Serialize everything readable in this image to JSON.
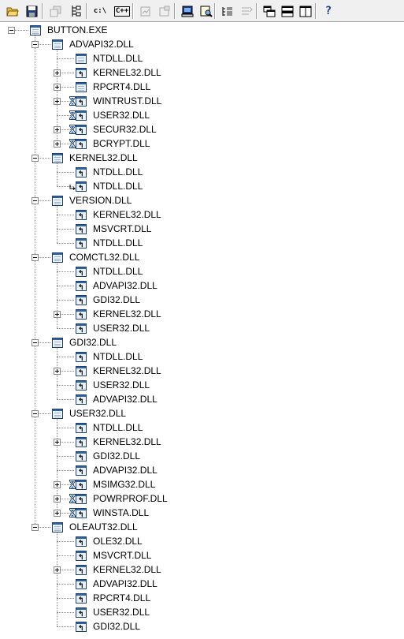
{
  "toolbar": {
    "buttons": [
      {
        "name": "open-icon",
        "glyph": "",
        "enabled": true
      },
      {
        "name": "save-icon",
        "glyph": "",
        "enabled": true
      },
      {
        "name": "copy-icon",
        "glyph": "",
        "enabled": false
      },
      {
        "name": "configure-search-paths-icon",
        "glyph": "",
        "enabled": true
      },
      {
        "name": "full-paths-icon",
        "glyph": "c:\\",
        "enabled": true
      },
      {
        "name": "undecorate-cpp-icon",
        "glyph": "C++",
        "enabled": true
      },
      {
        "name": "ordinal-icon",
        "glyph": "",
        "enabled": false
      },
      {
        "name": "properties-icon",
        "glyph": "",
        "enabled": false
      },
      {
        "name": "system-info-icon",
        "glyph": "",
        "enabled": true
      },
      {
        "name": "find-icon",
        "glyph": "",
        "enabled": true
      },
      {
        "name": "expand-all-icon",
        "glyph": "",
        "enabled": true
      },
      {
        "name": "collapse-icon",
        "glyph": "",
        "enabled": false
      },
      {
        "name": "cascade-windows-icon",
        "glyph": "",
        "enabled": true
      },
      {
        "name": "tile-horizontally-icon",
        "glyph": "",
        "enabled": true
      },
      {
        "name": "tile-vertically-icon",
        "glyph": "",
        "enabled": true
      },
      {
        "name": "help-icon",
        "glyph": "?",
        "enabled": true
      }
    ]
  },
  "tree": [
    {
      "label": "BUTTON.EXE",
      "depth": 0,
      "expander": "minus",
      "icon": "exe",
      "badge": "none"
    },
    {
      "label": "ADVAPI32.DLL",
      "depth": 1,
      "expander": "minus",
      "icon": "module",
      "badge": "none"
    },
    {
      "label": "NTDLL.DLL",
      "depth": 2,
      "expander": "none",
      "icon": "module",
      "badge": "none"
    },
    {
      "label": "KERNEL32.DLL",
      "depth": 2,
      "expander": "plus",
      "icon": "module-dup",
      "badge": "none"
    },
    {
      "label": "RPCRT4.DLL",
      "depth": 2,
      "expander": "plus",
      "icon": "module",
      "badge": "none"
    },
    {
      "label": "WINTRUST.DLL",
      "depth": 2,
      "expander": "plus",
      "icon": "module-dup",
      "badge": "delay"
    },
    {
      "label": "USER32.DLL",
      "depth": 2,
      "expander": "none",
      "icon": "module-dup",
      "badge": "delay"
    },
    {
      "label": "SECUR32.DLL",
      "depth": 2,
      "expander": "plus",
      "icon": "module-dup",
      "badge": "delay"
    },
    {
      "label": "BCRYPT.DLL",
      "depth": 2,
      "expander": "plus",
      "icon": "module-dup",
      "badge": "delay"
    },
    {
      "label": "KERNEL32.DLL",
      "depth": 1,
      "expander": "minus",
      "icon": "module",
      "badge": "none"
    },
    {
      "label": "NTDLL.DLL",
      "depth": 2,
      "expander": "none",
      "icon": "module-dup",
      "badge": "none"
    },
    {
      "label": "NTDLL.DLL",
      "depth": 2,
      "expander": "none",
      "icon": "module-dup",
      "badge": "forward"
    },
    {
      "label": "VERSION.DLL",
      "depth": 1,
      "expander": "minus",
      "icon": "module",
      "badge": "none"
    },
    {
      "label": "KERNEL32.DLL",
      "depth": 2,
      "expander": "none",
      "icon": "module-dup",
      "badge": "none"
    },
    {
      "label": "MSVCRT.DLL",
      "depth": 2,
      "expander": "none",
      "icon": "module-dup",
      "badge": "none"
    },
    {
      "label": "NTDLL.DLL",
      "depth": 2,
      "expander": "none",
      "icon": "module-dup",
      "badge": "none"
    },
    {
      "label": "COMCTL32.DLL",
      "depth": 1,
      "expander": "minus",
      "icon": "module",
      "badge": "none"
    },
    {
      "label": "NTDLL.DLL",
      "depth": 2,
      "expander": "none",
      "icon": "module-dup",
      "badge": "none"
    },
    {
      "label": "ADVAPI32.DLL",
      "depth": 2,
      "expander": "none",
      "icon": "module-dup",
      "badge": "none"
    },
    {
      "label": "GDI32.DLL",
      "depth": 2,
      "expander": "none",
      "icon": "module-dup",
      "badge": "none"
    },
    {
      "label": "KERNEL32.DLL",
      "depth": 2,
      "expander": "plus",
      "icon": "module-dup",
      "badge": "none"
    },
    {
      "label": "USER32.DLL",
      "depth": 2,
      "expander": "none",
      "icon": "module-dup",
      "badge": "none"
    },
    {
      "label": "GDI32.DLL",
      "depth": 1,
      "expander": "minus",
      "icon": "module",
      "badge": "none"
    },
    {
      "label": "NTDLL.DLL",
      "depth": 2,
      "expander": "none",
      "icon": "module-dup",
      "badge": "none"
    },
    {
      "label": "KERNEL32.DLL",
      "depth": 2,
      "expander": "plus",
      "icon": "module-dup",
      "badge": "none"
    },
    {
      "label": "USER32.DLL",
      "depth": 2,
      "expander": "none",
      "icon": "module-dup",
      "badge": "none"
    },
    {
      "label": "ADVAPI32.DLL",
      "depth": 2,
      "expander": "none",
      "icon": "module-dup",
      "badge": "none"
    },
    {
      "label": "USER32.DLL",
      "depth": 1,
      "expander": "minus",
      "icon": "module",
      "badge": "none"
    },
    {
      "label": "NTDLL.DLL",
      "depth": 2,
      "expander": "none",
      "icon": "module-dup",
      "badge": "none"
    },
    {
      "label": "KERNEL32.DLL",
      "depth": 2,
      "expander": "plus",
      "icon": "module-dup",
      "badge": "none"
    },
    {
      "label": "GDI32.DLL",
      "depth": 2,
      "expander": "none",
      "icon": "module-dup",
      "badge": "none"
    },
    {
      "label": "ADVAPI32.DLL",
      "depth": 2,
      "expander": "none",
      "icon": "module-dup",
      "badge": "none"
    },
    {
      "label": "MSIMG32.DLL",
      "depth": 2,
      "expander": "plus",
      "icon": "module-dup",
      "badge": "delay"
    },
    {
      "label": "POWRPROF.DLL",
      "depth": 2,
      "expander": "plus",
      "icon": "module-dup",
      "badge": "delay"
    },
    {
      "label": "WINSTA.DLL",
      "depth": 2,
      "expander": "plus",
      "icon": "module-dup",
      "badge": "delay"
    },
    {
      "label": "OLEAUT32.DLL",
      "depth": 1,
      "expander": "minus",
      "icon": "module",
      "badge": "none"
    },
    {
      "label": "OLE32.DLL",
      "depth": 2,
      "expander": "none",
      "icon": "module-dup",
      "badge": "none"
    },
    {
      "label": "MSVCRT.DLL",
      "depth": 2,
      "expander": "none",
      "icon": "module-dup",
      "badge": "none"
    },
    {
      "label": "KERNEL32.DLL",
      "depth": 2,
      "expander": "plus",
      "icon": "module-dup",
      "badge": "none"
    },
    {
      "label": "ADVAPI32.DLL",
      "depth": 2,
      "expander": "none",
      "icon": "module-dup",
      "badge": "none"
    },
    {
      "label": "RPCRT4.DLL",
      "depth": 2,
      "expander": "none",
      "icon": "module-dup",
      "badge": "none"
    },
    {
      "label": "USER32.DLL",
      "depth": 2,
      "expander": "none",
      "icon": "module-dup",
      "badge": "none"
    },
    {
      "label": "GDI32.DLL",
      "depth": 2,
      "expander": "none",
      "icon": "module-dup",
      "badge": "none"
    }
  ]
}
